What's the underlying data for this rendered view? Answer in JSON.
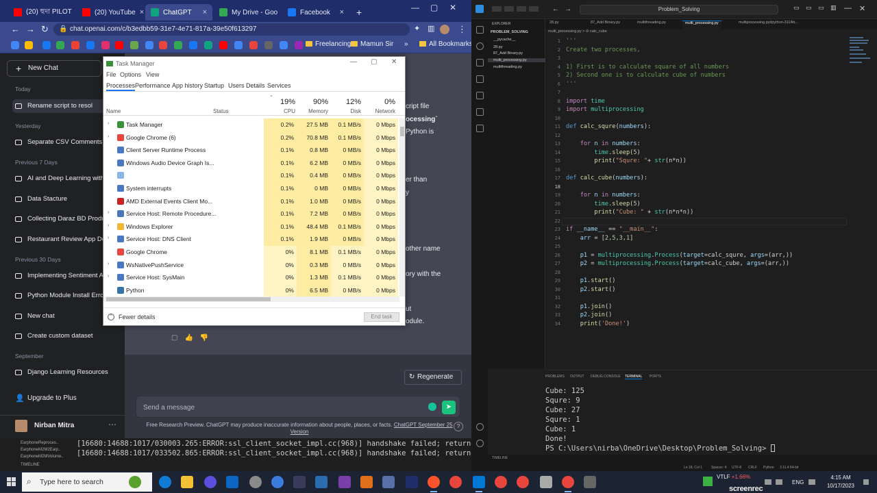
{
  "chrome": {
    "tabs": [
      {
        "label": "(20) হুদা PILOT",
        "color": "#ff0000"
      },
      {
        "label": "(20) YouTube",
        "color": "#ff0000"
      },
      {
        "label": "ChatGPT",
        "color": "#10a37f"
      },
      {
        "label": "My Drive - Goo",
        "color": "#34a853"
      },
      {
        "label": "Facebook",
        "color": "#1877f2"
      }
    ],
    "new_tab": "+",
    "url": "chat.openai.com/c/b3edbb59-31e7-4e71-817a-39e50f613297",
    "bookmarks": {
      "folder1": "Freelancing",
      "folder2": "Mamun Sir",
      "all": "All Bookmarks"
    }
  },
  "chatgpt": {
    "new_chat": "New Chat",
    "sections": {
      "today": "Today",
      "yesterday": "Yesterday",
      "prev7": "Previous 7 Days",
      "prev30": "Previous 30 Days",
      "september": "September"
    },
    "today_items": [
      "Rename script to resol"
    ],
    "yesterday_items": [
      "Separate CSV Comments"
    ],
    "prev7_items": [
      "AI and Deep Learning with",
      "Data Stacture",
      "Collecting Daraz BD Produ",
      "Restaurant Review App De"
    ],
    "prev30_items": [
      "Implementing Sentiment A",
      "Python Module Install Erro",
      "New chat",
      "Create custom dataset"
    ],
    "september_items": [
      "Django Learning Resources"
    ],
    "upgrade": "Upgrade to Plus",
    "user": "Nirban Mitra",
    "fragments": {
      "f1": "cript file",
      "f2": "ocessing`",
      "f3": "Python is",
      "f4": "er than",
      "f5": "y",
      "f6": "other name",
      "f7": "ory with the",
      "f8": "ut",
      "f9": "odule."
    },
    "regenerate": "Regenerate",
    "input_placeholder": "Send a message",
    "disclaimer": "Free Research Preview. ChatGPT may produce inaccurate information about people, places, or facts.",
    "disclaimer_link": "ChatGPT September 25 Version",
    "help": "?"
  },
  "taskmgr": {
    "title": "Task Manager",
    "menu": [
      "File",
      "Options",
      "View"
    ],
    "tabs": [
      "Processes",
      "Performance",
      "App history",
      "Startup",
      "Users",
      "Details",
      "Services"
    ],
    "columns": {
      "name": "Name",
      "status": "Status",
      "cpu": "CPU",
      "memory": "Memory",
      "disk": "Disk",
      "network": "Network"
    },
    "totals": {
      "cpu": "19%",
      "memory": "90%",
      "disk": "12%",
      "network": "0%"
    },
    "rows": [
      {
        "name": "Task Manager",
        "cpu": "0.2%",
        "mem": "27.5 MB",
        "disk": "0.1 MB/s",
        "net": "0 Mbps",
        "exp": "›",
        "color": "#3a8f3a"
      },
      {
        "name": "Google Chrome (6)",
        "cpu": "0.2%",
        "mem": "70.8 MB",
        "disk": "0.1 MB/s",
        "net": "0 Mbps",
        "exp": "›",
        "color": "#e8453c"
      },
      {
        "name": "Client Server Runtime Process",
        "cpu": "0.1%",
        "mem": "0.8 MB",
        "disk": "0 MB/s",
        "net": "0 Mbps",
        "exp": "",
        "color": "#4a78c2"
      },
      {
        "name": "Windows Audio Device Graph Is...",
        "cpu": "0.1%",
        "mem": "6.2 MB",
        "disk": "0 MB/s",
        "net": "0 Mbps",
        "exp": "",
        "color": "#4a78c2"
      },
      {
        "name": "",
        "cpu": "0.1%",
        "mem": "0.4 MB",
        "disk": "0 MB/s",
        "net": "0 Mbps",
        "exp": "",
        "color": "#8ab4e8"
      },
      {
        "name": "System interrupts",
        "cpu": "0.1%",
        "mem": "0 MB",
        "disk": "0 MB/s",
        "net": "0 Mbps",
        "exp": "",
        "color": "#4a78c2"
      },
      {
        "name": "AMD External Events Client Mo...",
        "cpu": "0.1%",
        "mem": "1.0 MB",
        "disk": "0 MB/s",
        "net": "0 Mbps",
        "exp": "",
        "color": "#cc2222"
      },
      {
        "name": "Service Host: Remote Procedure...",
        "cpu": "0.1%",
        "mem": "7.2 MB",
        "disk": "0 MB/s",
        "net": "0 Mbps",
        "exp": "›",
        "color": "#4a78c2"
      },
      {
        "name": "Windows Explorer",
        "cpu": "0.1%",
        "mem": "48.4 MB",
        "disk": "0.1 MB/s",
        "net": "0 Mbps",
        "exp": "›",
        "color": "#f2b632"
      },
      {
        "name": "Service Host: DNS Client",
        "cpu": "0.1%",
        "mem": "1.9 MB",
        "disk": "0 MB/s",
        "net": "0 Mbps",
        "exp": "›",
        "color": "#4a78c2"
      },
      {
        "name": "Google Chrome",
        "cpu": "0%",
        "mem": "8.1 MB",
        "disk": "0.1 MB/s",
        "net": "0 Mbps",
        "exp": "",
        "color": "#e8453c"
      },
      {
        "name": "WsNativePushService",
        "cpu": "0%",
        "mem": "0.3 MB",
        "disk": "0 MB/s",
        "net": "0 Mbps",
        "exp": "›",
        "color": "#4a78c2"
      },
      {
        "name": "Service Host: SysMain",
        "cpu": "0%",
        "mem": "1.3 MB",
        "disk": "0.1 MB/s",
        "net": "0 Mbps",
        "exp": "›",
        "color": "#4a78c2"
      },
      {
        "name": "Python",
        "cpu": "0%",
        "mem": "6.5 MB",
        "disk": "0 MB/s",
        "net": "0 Mbps",
        "exp": "",
        "color": "#3572a5"
      }
    ],
    "fewer_details": "Fewer details",
    "end_task": "End task"
  },
  "left_terminal": {
    "line1": "[16680:14688:1017/030003.265:ERROR:ssl_client_socket_impl.cc(968)] handshake failed; returned -1",
    "line2": "[16680:14688:1017/033502.865:ERROR:ssl_client_socket_impl.cc(968)] handshake failed; returned -1",
    "side1": "EarphoneReproces..",
    "side2": "EarphoneM2M2Earp..",
    "side3": "EarphoneM2MVolume..",
    "timeline": "TIMELINE"
  },
  "vscode": {
    "search": "Problem_Solving",
    "explorer_title": "EXPLORER",
    "folder": "PROBLEM_SOLVING",
    "files": [
      "__pycache__",
      "28.py",
      "87_Add Binary.py",
      "multi_processing.py",
      "multithreading.py"
    ],
    "tabs": [
      "28.py",
      "87_Add Binary.py",
      "multithreading.py",
      "multi_processing.py",
      "multiprocessing.pyi/python-311/lib..."
    ],
    "breadcrumb": "multi_processing.py > ⊘ calc_cube",
    "panel_tabs": [
      "PROBLEMS",
      "OUTPUT",
      "DEBUG CONSOLE",
      "TERMINAL",
      "PORTS"
    ],
    "terminal_lines": [
      "Cube: 125",
      "Squre: 9",
      "Cube: 27",
      "Squre: 1",
      "Cube: 1",
      "Done!"
    ],
    "prompt": "PS C:\\Users\\nirba\\OneDrive\\Desktop\\Problem_Solving> ",
    "timeline": "TIMELINE",
    "outline": "OUTLINE",
    "status_items": [
      "Ln 18, Col 1",
      "Spaces: 4",
      "UTF-8",
      "CRLF",
      "Python",
      "3.11.4 64-bit"
    ]
  },
  "code": {
    "l1": "'''",
    "l2": "Create two processes,",
    "l4": "1) First is to calculate square of all numbers",
    "l5": "2) Second one is to calculate cube of numbers",
    "l6": "'''",
    "l8a": "import",
    "l8b": " time",
    "l9a": "import",
    "l9b": " multiprocessing",
    "l11a": "def",
    "l11b": " calc_squre",
    "l11c": "(",
    "l11d": "numbers",
    "l11e": "):",
    "l13a": "    for",
    "l13b": " n ",
    "l13c": "in",
    "l13d": " numbers",
    "l13e": ":",
    "l14a": "        time",
    "l14b": ".",
    "l14c": "sleep",
    "l14d": "(",
    "l14e": "5",
    "l14f": ")",
    "l15a": "        print",
    "l15b": "(",
    "l15c": "\"Squre: \"",
    "l15d": "+ ",
    "l15e": "str",
    "l15f": "(n*n))",
    "l17a": "def",
    "l17b": " calc_cube",
    "l17c": "(",
    "l17d": "numbers",
    "l17e": "):",
    "l19a": "    for",
    "l19b": " n ",
    "l19c": "in",
    "l19d": " numbers",
    "l19e": ":",
    "l20a": "        time",
    "l20b": ".",
    "l20c": "sleep",
    "l20d": "(",
    "l20e": "5",
    "l20f": ")",
    "l21a": "        print",
    "l21b": "(",
    "l21c": "\"Cube: \"",
    "l21d": " + ",
    "l21e": "str",
    "l21f": "(n*n*n))",
    "l23a": "if",
    "l23b": " __name__",
    "l23c": " == ",
    "l23d": "\"__main__\"",
    "l23e": ":",
    "l24a": "    arr",
    "l24b": " = [",
    "l24c": "2,5,3,1",
    "l24d": "]",
    "l26a": "    p1",
    "l26b": " = ",
    "l26c": "multiprocessing",
    "l26d": ".",
    "l26e": "Process",
    "l26f": "(",
    "l26g": "target",
    "l26h": "=calc_squre, ",
    "l26i": "args",
    "l26j": "=(arr,))",
    "l27a": "    p2",
    "l27b": " = ",
    "l27c": "multiprocessing",
    "l27d": ".",
    "l27e": "Process",
    "l27f": "(",
    "l27g": "target",
    "l27h": "=calc_cube, ",
    "l27i": "args",
    "l27j": "=(arr,))",
    "l29a": "    p1",
    "l29b": ".",
    "l29c": "start",
    "l29d": "()",
    "l30a": "    p2",
    "l30b": ".",
    "l30c": "start",
    "l30d": "()",
    "l32a": "    p1",
    "l32b": ".",
    "l32c": "join",
    "l32d": "()",
    "l33a": "    p2",
    "l33b": ".",
    "l33c": "join",
    "l33d": "()",
    "l34a": "    print",
    "l34b": "(",
    "l34c": "'Done!'",
    "l34d": ")"
  },
  "taskbar": {
    "search_placeholder": "Type here to search",
    "weather": "VTLF",
    "weather_change": "+1.66%",
    "lang": "ENG",
    "time": "4:15 AM",
    "date": "10/17/2023",
    "watermark": "screenrec"
  },
  "colors": {
    "chatgpt_green": "#19c37d",
    "vscode_accent": "#0078d4",
    "chrome_frame": "#1f2d6b"
  }
}
